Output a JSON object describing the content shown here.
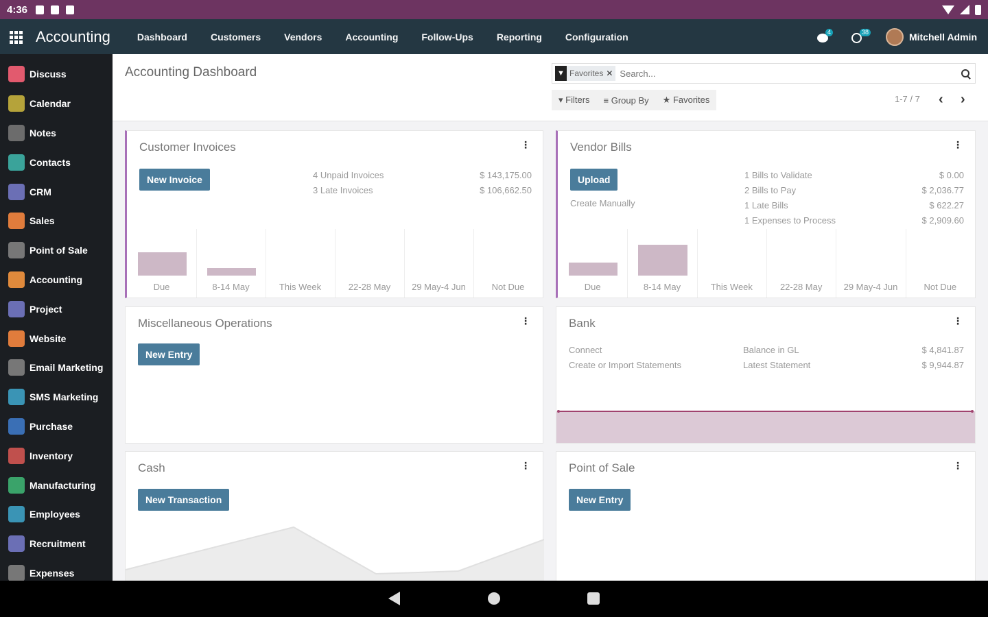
{
  "status": {
    "time": "4:36"
  },
  "topnav": {
    "app_title": "Accounting",
    "menu": [
      "Dashboard",
      "Customers",
      "Vendors",
      "Accounting",
      "Follow-Ups",
      "Reporting",
      "Configuration"
    ],
    "messages_badge": "4",
    "activities_badge": "38",
    "user_name": "Mitchell Admin"
  },
  "sidebar": {
    "items": [
      {
        "label": "Discuss",
        "icon": "chat-icon",
        "color": "#e25a6e"
      },
      {
        "label": "Calendar",
        "icon": "calendar-icon",
        "color": "#b5a33a"
      },
      {
        "label": "Notes",
        "icon": "notes-icon",
        "color": "#6c6c6c"
      },
      {
        "label": "Contacts",
        "icon": "contacts-icon",
        "color": "#3aa39a"
      },
      {
        "label": "CRM",
        "icon": "crm-icon",
        "color": "#6b6fb5"
      },
      {
        "label": "Sales",
        "icon": "sales-icon",
        "color": "#e07c3c"
      },
      {
        "label": "Point of Sale",
        "icon": "pos-icon",
        "color": "#777"
      },
      {
        "label": "Accounting",
        "icon": "accounting-icon",
        "color": "#e08a3c"
      },
      {
        "label": "Project",
        "icon": "project-icon",
        "color": "#6b6fb5"
      },
      {
        "label": "Website",
        "icon": "website-icon",
        "color": "#e07c3c"
      },
      {
        "label": "Email Marketing",
        "icon": "email-icon",
        "color": "#777"
      },
      {
        "label": "SMS Marketing",
        "icon": "sms-icon",
        "color": "#3a94b5"
      },
      {
        "label": "Purchase",
        "icon": "purchase-icon",
        "color": "#3a6fb5"
      },
      {
        "label": "Inventory",
        "icon": "inventory-icon",
        "color": "#c0504d"
      },
      {
        "label": "Manufacturing",
        "icon": "manufacturing-icon",
        "color": "#3aa36a"
      },
      {
        "label": "Employees",
        "icon": "employees-icon",
        "color": "#3a94b5"
      },
      {
        "label": "Recruitment",
        "icon": "recruitment-icon",
        "color": "#6b6fb5"
      },
      {
        "label": "Expenses",
        "icon": "expenses-icon",
        "color": "#777"
      }
    ]
  },
  "control": {
    "title": "Accounting Dashboard",
    "facet": "Favorites",
    "search_placeholder": "Search...",
    "filters": "Filters",
    "group_by": "Group By",
    "favorites": "Favorites",
    "pager": "1-7 / 7"
  },
  "cards": {
    "customer_invoices": {
      "title": "Customer Invoices",
      "button": "New Invoice",
      "stats": [
        {
          "label": "4 Unpaid Invoices",
          "value": "$ 143,175.00"
        },
        {
          "label": "3 Late Invoices",
          "value": "$ 106,662.50"
        }
      ],
      "graph_labels": [
        "Due",
        "8-14 May",
        "This Week",
        "22-28 May",
        "29 May-4 Jun",
        "Not Due"
      ]
    },
    "vendor_bills": {
      "title": "Vendor Bills",
      "button": "Upload",
      "link": "Create Manually",
      "stats": [
        {
          "label": "1 Bills to Validate",
          "value": "$ 0.00"
        },
        {
          "label": "2 Bills to Pay",
          "value": "$ 2,036.77"
        },
        {
          "label": "1 Late Bills",
          "value": "$ 622.27"
        },
        {
          "label": "1 Expenses to Process",
          "value": "$ 2,909.60"
        }
      ],
      "graph_labels": [
        "Due",
        "8-14 May",
        "This Week",
        "22-28 May",
        "29 May-4 Jun",
        "Not Due"
      ]
    },
    "misc": {
      "title": "Miscellaneous Operations",
      "button": "New Entry"
    },
    "bank": {
      "title": "Bank",
      "links": [
        "Connect",
        "Create or Import Statements"
      ],
      "stats": [
        {
          "label": "Balance in GL",
          "value": "$ 4,841.87"
        },
        {
          "label": "Latest Statement",
          "value": "$ 9,944.87"
        }
      ]
    },
    "cash": {
      "title": "Cash",
      "button": "New Transaction"
    },
    "pos": {
      "title": "Point of Sale",
      "button": "New Entry"
    }
  }
}
